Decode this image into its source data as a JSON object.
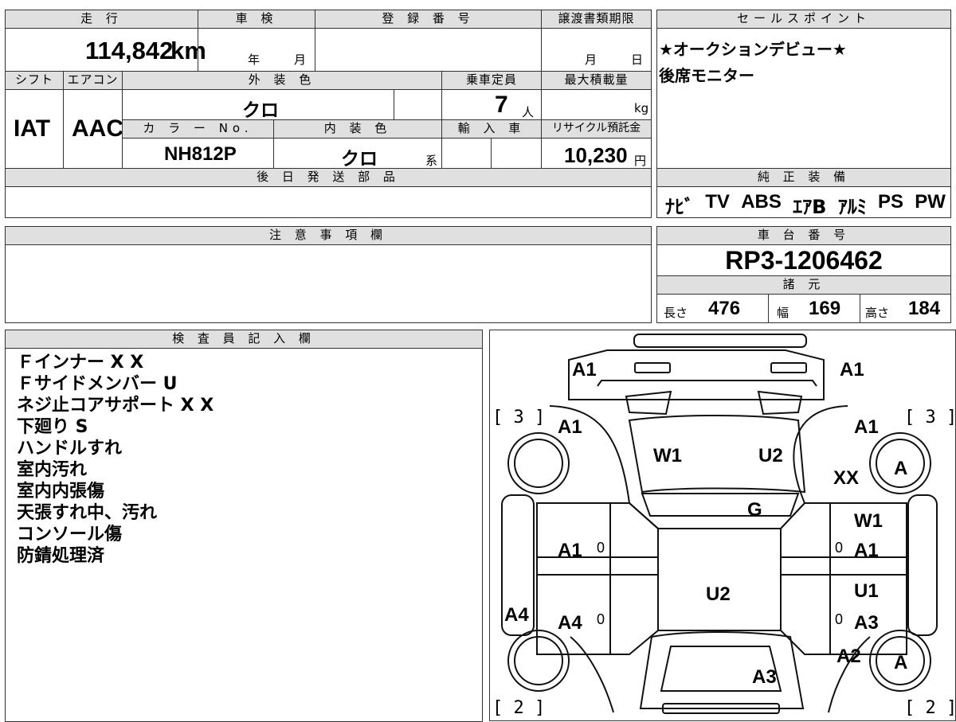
{
  "top": {
    "mileage_label": "走 行",
    "mileage_value": "114,842",
    "mileage_unit": "km",
    "inspection_label": "車 検",
    "inspection_year_unit": "年",
    "inspection_month_unit": "月",
    "reg_label": "登 録 番 号",
    "transfer_label": "譲渡書類期限",
    "transfer_month_unit": "月",
    "transfer_day_unit": "日",
    "shift_label": "シフト",
    "shift_value": "IAT",
    "ac_label": "エアコン",
    "ac_value": "AAC",
    "ext_color_label": "外 装 色",
    "ext_color_value": "クロ",
    "capacity_label": "乗車定員",
    "capacity_value": "7",
    "capacity_unit": "人",
    "maxload_label": "最大積載量",
    "maxload_unit": "kg",
    "color_no_label": "カ ラ ー No.",
    "color_no_value": "NH812P",
    "int_color_label": "内 装 色",
    "int_color_value": "クロ",
    "int_color_suffix": "系",
    "import_label": "輸 入 車",
    "recycle_label": "リサイクル預託金",
    "recycle_value": "10,230",
    "recycle_unit": "円",
    "later_parts_label": "後 日 発 送 部 品"
  },
  "sales": {
    "header": "セールスポイント",
    "lines": [
      "★オークションデビュー★",
      "後席モニター"
    ]
  },
  "equipment": {
    "header": "純 正 装 備",
    "items": [
      "ﾅﾋﾞ",
      "TV",
      "ABS",
      "ｴｱB",
      "ｱﾙﾐ",
      "PS",
      "PW"
    ]
  },
  "notes": {
    "header": "注 意 事 項 欄"
  },
  "chassis": {
    "header": "車 台 番 号",
    "value": "RP3-1206462",
    "spec_header": "諸 元",
    "length_label": "長さ",
    "length_value": "476",
    "width_label": "幅",
    "width_value": "169",
    "height_label": "高さ",
    "height_value": "184"
  },
  "inspector": {
    "header": "検 査 員 記 入 欄",
    "lines": [
      "Ｆインナー X X",
      "Ｆサイドメンバー U",
      "ネジ止コアサポート X X",
      "下廻り S",
      "ハンドルすれ",
      "室内汚れ",
      "室内内張傷",
      "天張すれ中、汚れ",
      "コンソール傷",
      "防錆処理済"
    ]
  },
  "diagram": {
    "marks": {
      "front_left": "A1",
      "front_right": "A1",
      "fender_fl": "A1",
      "fender_fr": "A1",
      "hood_left": "W1",
      "hood_right": "U2",
      "right_xx": "XX",
      "windshield": "G",
      "door_fl": "A1",
      "door_fr_top": "W1",
      "door_fr": "A1",
      "roof": "U2",
      "door_rr_top": "U1",
      "door_rr": "A3",
      "left_sill": "A4",
      "door_rl": "A4",
      "quarter_rr": "A2",
      "rear_gate": "A3",
      "tire_right_front": "A",
      "tire_right_rear": "A",
      "bracket_fl": "[ 3 ]",
      "bracket_fr": "[ 3 ]",
      "bracket_rl": "[ 2 ]",
      "bracket_rr": "[ 2 ]",
      "zero": "0"
    }
  }
}
